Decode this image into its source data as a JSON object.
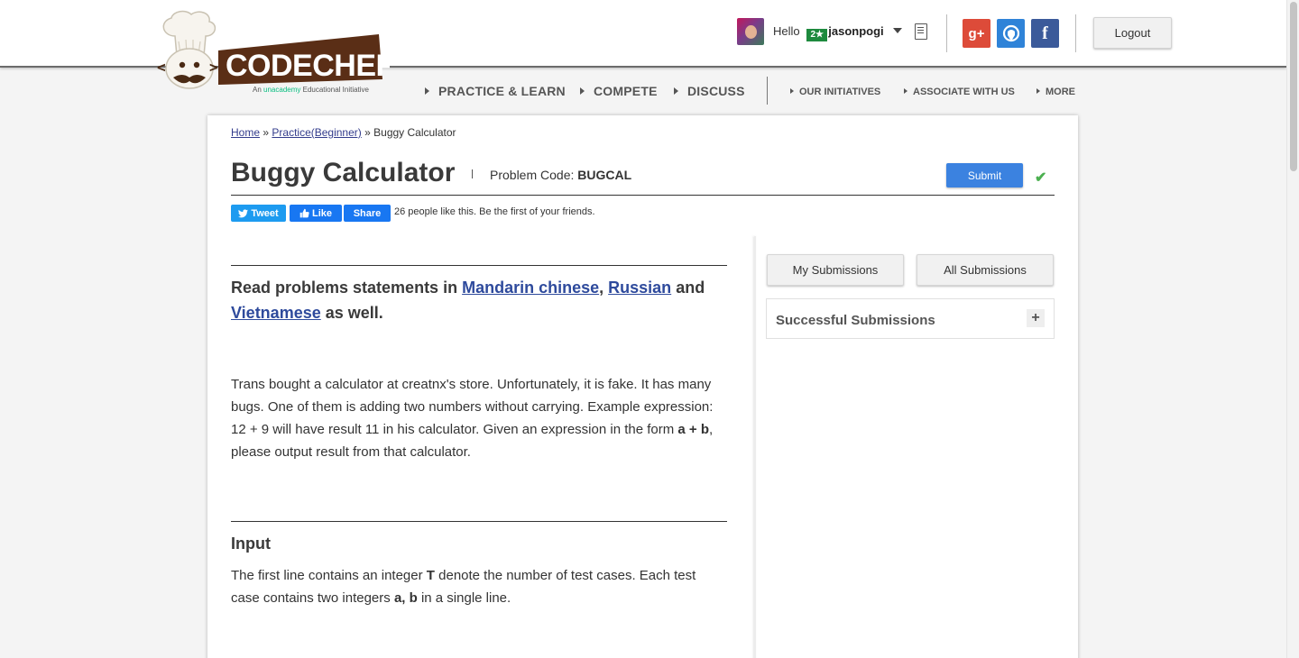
{
  "header": {
    "logo_text": "CODECHEF",
    "logo_tagline_pre": "An",
    "logo_tagline_brand": "unacademy",
    "logo_tagline_post": "Educational Initiative",
    "greeting": "Hello",
    "rating_badge": "2★",
    "username": "jasonpogi",
    "logout_label": "Logout",
    "social": {
      "gplus": "g+",
      "facebook": "f"
    }
  },
  "nav": {
    "main": [
      "PRACTICE & LEARN",
      "COMPETE",
      "DISCUSS"
    ],
    "secondary": [
      "OUR INITIATIVES",
      "ASSOCIATE WITH US",
      "MORE"
    ]
  },
  "breadcrumb": {
    "home": "Home",
    "sep": "»",
    "practice": "Practice(Beginner)",
    "current": "Buggy Calculator"
  },
  "problem": {
    "title": "Buggy Calculator",
    "code_label": "Problem Code:",
    "code": "BUGCAL",
    "submit_label": "Submit"
  },
  "share": {
    "tweet": "Tweet",
    "like": "Like",
    "share": "Share",
    "likes_text": "26 people like this. Be the first of your friends."
  },
  "statement": {
    "lang_prefix": "Read problems statements in",
    "lang_1": "Mandarin chinese",
    "lang_2": "Russian",
    "lang_and": "and",
    "lang_3": "Vietnamese",
    "lang_suffix": "as well.",
    "body_1": "Trans bought a calculator at creatnx's store. Unfortunately, it is fake. It has many bugs. One of them is adding two numbers without carrying. Example expression: 12 + 9 will have result 11 in his calculator. Given an expression in the form",
    "body_expr": "a + b",
    "body_2": ", please output result from that calculator.",
    "input_heading": "Input",
    "input_1": "The first line contains an integer",
    "input_T": "T",
    "input_2": "denote the number of test cases. Each test case contains two integers",
    "input_ab": "a, b",
    "input_3": "in a single line."
  },
  "sidebar": {
    "my_submissions": "My Submissions",
    "all_submissions": "All Submissions",
    "successful_submissions": "Successful Submissions",
    "expand_symbol": "+"
  },
  "colors": {
    "accent_blue": "#3b82e0",
    "link_blue": "#2e4a9c",
    "logo_brown": "#5a2e16",
    "success_green": "#4cb050"
  }
}
